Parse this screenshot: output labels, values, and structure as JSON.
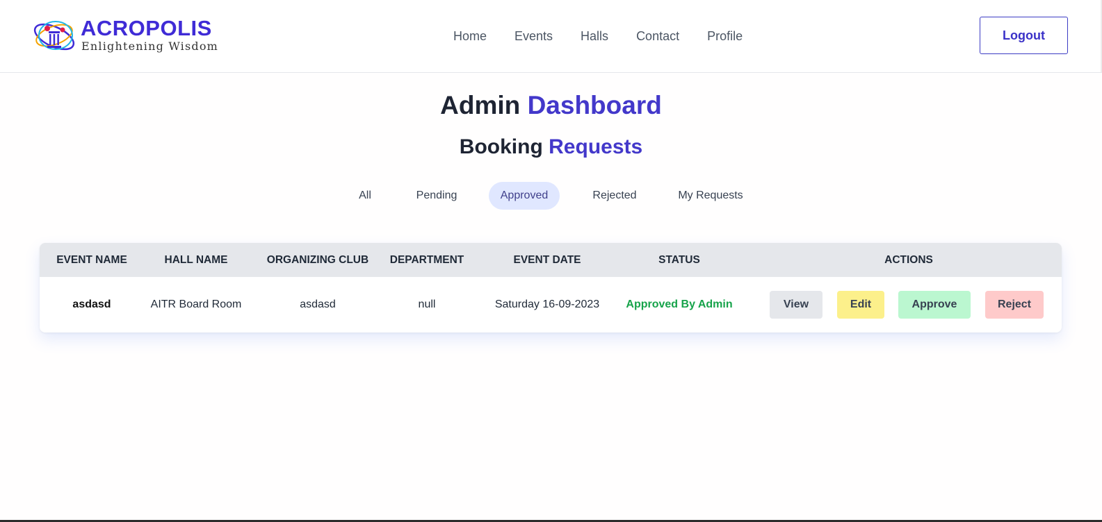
{
  "brand": {
    "title": "ACROPOLIS",
    "tagline": "Enlightening Wisdom"
  },
  "nav": {
    "items": [
      "Home",
      "Events",
      "Halls",
      "Contact",
      "Profile"
    ],
    "logout_label": "Logout"
  },
  "page": {
    "title_plain": "Admin",
    "title_accent": "Dashboard",
    "subtitle_plain": "Booking",
    "subtitle_accent": "Requests"
  },
  "tabs": {
    "items": [
      "All",
      "Pending",
      "Approved",
      "Rejected",
      "My Requests"
    ],
    "active": "Approved"
  },
  "table": {
    "headers": [
      "EVENT NAME",
      "HALL NAME",
      "ORGANIZING CLUB",
      "DEPARTMENT",
      "EVENT DATE",
      "STATUS",
      "ACTIONS"
    ],
    "rows": [
      {
        "event_name": "asdasd",
        "hall_name": "AITR Board Room",
        "organizing_club": "asdasd",
        "department": "null",
        "event_date": "Saturday 16-09-2023",
        "status": "Approved By Admin"
      }
    ],
    "actions": {
      "view": "View",
      "edit": "Edit",
      "approve": "Approve",
      "reject": "Reject"
    }
  },
  "colors": {
    "accent": "#4338ca",
    "status_approved": "#16a34a",
    "active_tab_bg": "#e0e7ff",
    "header_bg": "#e5e7eb",
    "view_bg": "#e5e7eb",
    "edit_bg": "#fcf08b",
    "approve_bg": "#bbf7d0",
    "reject_bg": "#fecaca"
  },
  "icons": {
    "logo": "acropolis-column-emblem-icon"
  }
}
